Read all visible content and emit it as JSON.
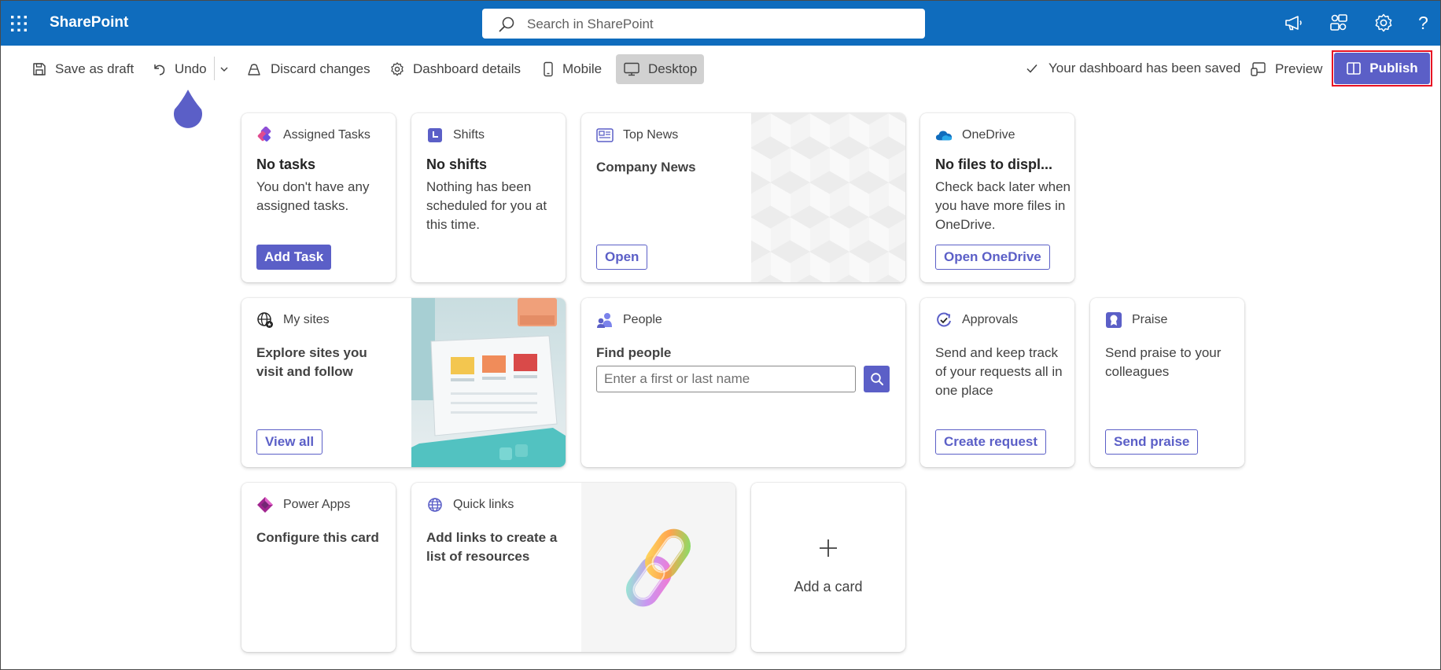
{
  "suite_bar": {
    "app_name": "SharePoint",
    "search_placeholder": "Search in SharePoint",
    "bg_color": "#0f6cbd",
    "right_icons": [
      "megaphone-icon",
      "share-icon",
      "settings-icon",
      "help-icon"
    ],
    "help_glyph": "?"
  },
  "command_bar": {
    "save_draft": "Save as draft",
    "undo": "Undo",
    "discard": "Discard changes",
    "details": "Dashboard details",
    "mobile": "Mobile",
    "desktop": "Desktop",
    "saved_status": "Your dashboard has been saved",
    "preview": "Preview",
    "publish": "Publish",
    "accent_color": "#5b5fc7"
  },
  "cards": {
    "assigned_tasks": {
      "header": "Assigned Tasks",
      "title": "No tasks",
      "description": "You don't have any assigned tasks.",
      "button": "Add Task"
    },
    "shifts": {
      "header": "Shifts",
      "title": "No shifts",
      "description": "Nothing has been scheduled for you at this time."
    },
    "top_news": {
      "header": "Top News",
      "title": "Company News",
      "button": "Open"
    },
    "onedrive": {
      "header": "OneDrive",
      "title": "No files to displ...",
      "description": "Check back later when you have more files in OneDrive.",
      "button": "Open OneDrive"
    },
    "my_sites": {
      "header": "My sites",
      "title": "Explore sites you visit and follow",
      "button": "View all"
    },
    "people": {
      "header": "People",
      "title": "Find people",
      "input_placeholder": "Enter a first or last name"
    },
    "approvals": {
      "header": "Approvals",
      "description": "Send and keep track of your requests all in one place",
      "button": "Create request"
    },
    "praise": {
      "header": "Praise",
      "description": "Send praise to your colleagues",
      "button": "Send praise"
    },
    "power_apps": {
      "header": "Power Apps",
      "title": "Configure this card"
    },
    "quick_links": {
      "header": "Quick links",
      "title": "Add links to create a list of resources"
    },
    "add_card": {
      "label": "Add a card",
      "glyph": "+"
    }
  }
}
